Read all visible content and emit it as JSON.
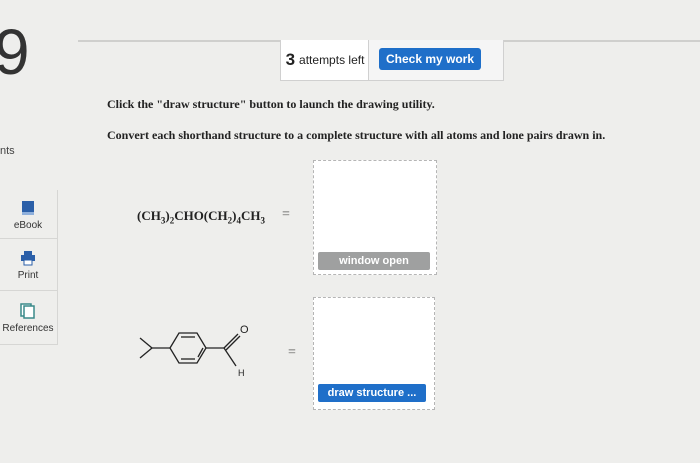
{
  "question": {
    "number": "9",
    "points_label": "nts"
  },
  "sidebar": {
    "items": [
      {
        "label": "eBook",
        "icon": "book-icon"
      },
      {
        "label": "Print",
        "icon": "printer-icon"
      },
      {
        "label": "References",
        "icon": "documents-icon"
      }
    ]
  },
  "header": {
    "attempts_count": "3",
    "attempts_text": "attempts left",
    "check_label": "Check my work"
  },
  "instructions": {
    "line1": "Click the \"draw structure\" button to launch the drawing utility.",
    "line2": "Convert each shorthand structure to a complete structure with all atoms and lone pairs drawn in."
  },
  "problems": [
    {
      "formula": "(CH3)2CHO(CH2)4CH3",
      "equals": "=",
      "button_label": "window open"
    },
    {
      "structure_labels": {
        "oxygen": "O",
        "hydrogen": "H"
      },
      "equals": "=",
      "button_label": "draw structure ..."
    }
  ],
  "colors": {
    "accent_blue": "#1f6fc9",
    "disabled_gray": "#9fa0a0",
    "background": "#eeeeec"
  }
}
